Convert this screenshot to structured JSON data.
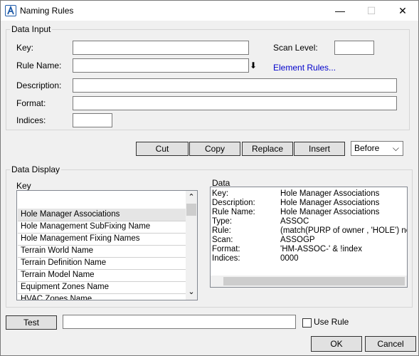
{
  "window": {
    "title": "Naming Rules",
    "minimize_glyph": "—",
    "maximize_glyph": "☐",
    "close_glyph": "✕"
  },
  "data_input": {
    "group_label": "Data Input",
    "key_label": "Key:",
    "key_value": "",
    "scan_level_label": "Scan Level:",
    "scan_level_value": "",
    "rule_name_label": "Rule Name:",
    "rule_name_value": "",
    "download_glyph": "⬇",
    "element_rules_link": "Element Rules...",
    "description_label": "Description:",
    "description_value": "",
    "format_label": "Format:",
    "format_value": "",
    "indices_label": "Indices:",
    "indices_value": ""
  },
  "toolbar": {
    "cut": "Cut",
    "copy": "Copy",
    "replace": "Replace",
    "insert": "Insert",
    "position_select": "Before",
    "caret": "⌵"
  },
  "data_display": {
    "group_label": "Data Display",
    "key_header": "Key",
    "data_header": "Data",
    "scroll_up": "⌃",
    "scroll_down": "⌄",
    "keys": [
      "Hole Manager Associations",
      "Hole Management SubFixing Name",
      "Hole Management Fixing Names",
      "Terrain World Name",
      "Terrain Definition Name",
      "Terrain Model Name",
      "Equipment Zones Name",
      "HVAC Zones Name"
    ],
    "data_rows": [
      {
        "key": "Key:",
        "value": "Hole Manager Associations"
      },
      {
        "key": "Description:",
        "value": "Hole Manager Associations"
      },
      {
        "key": "Rule Name:",
        "value": "Hole Manager Associations"
      },
      {
        "key": "Type:",
        "value": "ASSOC"
      },
      {
        "key": "Rule:",
        "value": "(match(PURP of owner , 'HOLE') neq"
      },
      {
        "key": "Scan:",
        "value": "ASSOGP"
      },
      {
        "key": "Format:",
        "value": "'HM-ASSOC-' & !index"
      },
      {
        "key": "Indices:",
        "value": "0000"
      }
    ]
  },
  "bottom": {
    "test_button": "Test",
    "test_value": "",
    "use_rule_label": "Use Rule",
    "ok_button": "OK",
    "cancel_button": "Cancel"
  }
}
